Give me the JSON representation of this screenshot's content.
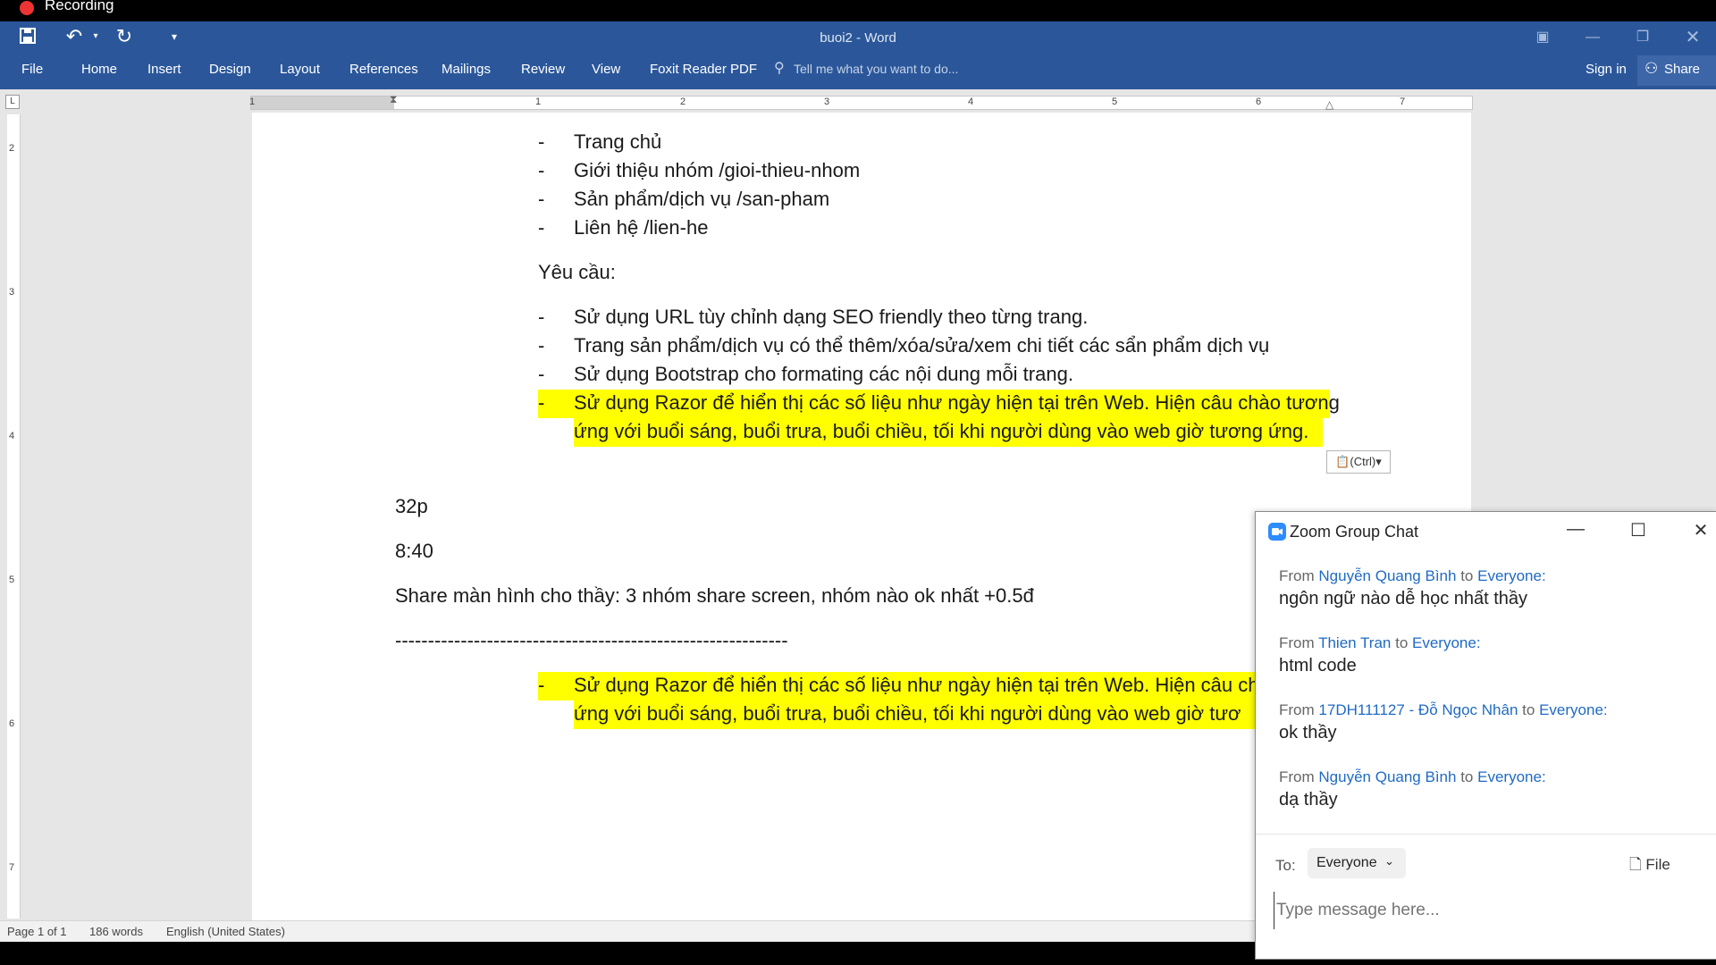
{
  "app": {
    "recording_label": "Recording",
    "window_title": "buoi2 - Word"
  },
  "ribbon": {
    "tabs": [
      "File",
      "Home",
      "Insert",
      "Design",
      "Layout",
      "References",
      "Mailings",
      "Review",
      "View",
      "Foxit Reader PDF"
    ],
    "tell_me": "Tell me what you want to do...",
    "sign_in": "Sign in",
    "share": "Share"
  },
  "ruler": {
    "numbers": [
      "1",
      "1",
      "2",
      "3",
      "4",
      "5",
      "6",
      "7"
    ]
  },
  "vruler": {
    "numbers": [
      "2",
      "3",
      "4",
      "5",
      "6",
      "7"
    ]
  },
  "document": {
    "list1": [
      "Trang chủ",
      "Giới thiệu nhóm /gioi-thieu-nhom",
      "Sản phẩm/dịch vụ /san-pham",
      "Liên hệ /lien-he"
    ],
    "requirements_heading": "Yêu cầu:",
    "list2": [
      "Sử dụng URL tùy chỉnh dạng SEO friendly theo từng trang.",
      "Trang sản phẩm/dịch vụ có thể thêm/xóa/sửa/xem chi tiết các sẩn phẩm dịch vụ",
      "Sử dụng Bootstrap cho formating các nội dung mỗi trang."
    ],
    "highlight_line1": "Sử dụng Razor để hiển thị các số liệu như ngày hiện tại trên Web. Hiện câu chào tương",
    "highlight_line2": "ứng với buổi sáng, buổi trưa, buổi chiều, tối khi người dùng vào web giờ tương ứng.",
    "paste_options": "(Ctrl)",
    "note1": "32p",
    "note2": "8:40",
    "note3": "Share màn hình cho thầy: 3 nhóm share screen, nhóm nào ok  nhất +0.5đ",
    "separator": "------------------------------------------------------------",
    "highlight2_line1": "Sử dụng Razor để hiển thị các số liệu như ngày hiện tại trên Web. Hiện câu chà",
    "highlight2_line2": "ứng với buổi sáng, buổi trưa, buổi chiều, tối khi người dùng vào web giờ tươ",
    "dash": "-"
  },
  "status": {
    "page": "Page 1 of 1",
    "words": "186 words",
    "language": "English (United States)"
  },
  "chat": {
    "title": "Zoom Group Chat",
    "messages": [
      {
        "from_prefix": "From",
        "sender": "Nguyễn Quang Bình",
        "to_word": "to",
        "recipient": "Everyone:",
        "text": "ngôn ngữ nào dễ học nhất thầy"
      },
      {
        "from_prefix": "From",
        "sender": "Thien Tran",
        "to_word": "to",
        "recipient": "Everyone:",
        "text": "html code"
      },
      {
        "from_prefix": "From",
        "sender": "17DH111127 - Đỗ Ngọc Nhân",
        "to_word": "to",
        "recipient": "Everyone:",
        "text": "ok thầy"
      },
      {
        "from_prefix": "From",
        "sender": "Nguyễn Quang Bình",
        "to_word": "to",
        "recipient": "Everyone:",
        "text": "dạ thầy"
      }
    ],
    "to_label": "To:",
    "to_value": "Everyone",
    "file_label": "File",
    "input_placeholder": "Type message here..."
  },
  "colors": {
    "word_blue": "#2b579a",
    "highlight": "#ffff00",
    "zoom_blue": "#2d8cff",
    "link_blue": "#1f6ac4"
  }
}
